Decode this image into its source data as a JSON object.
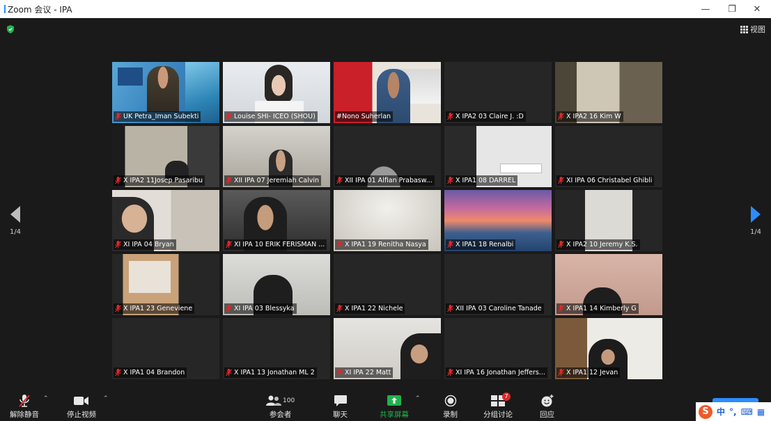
{
  "window": {
    "title": "Zoom 会议 - IPA"
  },
  "stage": {
    "view_label": "视图",
    "page_indicator_left": "1/4",
    "page_indicator_right": "1/4"
  },
  "participants": [
    {
      "name": "UK Petra_Iman Subekti",
      "muted": true,
      "active": false
    },
    {
      "name": "Louise SHI- ICEO (SHOU)",
      "muted": true,
      "active": false
    },
    {
      "name": "#Nono Suherlan",
      "muted": false,
      "active": true
    },
    {
      "name": "X IPA2 03 Claire J. :D",
      "muted": true,
      "active": false
    },
    {
      "name": "X IPA2 16 Kim W",
      "muted": true,
      "active": false
    },
    {
      "name": "X IPA2 11Josep Pasaribu",
      "muted": true,
      "active": false
    },
    {
      "name": "XII IPA 07 Jeremiah Calvin",
      "muted": true,
      "active": false
    },
    {
      "name": "XII IPA 01 Alfian Prabasw...",
      "muted": true,
      "active": false
    },
    {
      "name": "X IPA1 08 DARREL",
      "muted": true,
      "active": false
    },
    {
      "name": "XI IPA 06 Christabel Ghibli",
      "muted": true,
      "active": false
    },
    {
      "name": "XI IPA 04 Bryan",
      "muted": true,
      "active": false
    },
    {
      "name": "XI IPA 10 ERIK FERISMAN ...",
      "muted": true,
      "active": false
    },
    {
      "name": "X IPA1 19 Renitha Nasya",
      "muted": true,
      "active": false
    },
    {
      "name": "X IPA1 18 Renalbi",
      "muted": true,
      "active": false
    },
    {
      "name": "X IPA2 10 Jeremy K.S.",
      "muted": true,
      "active": false
    },
    {
      "name": "X IPA1 23 Geneviene",
      "muted": true,
      "active": false
    },
    {
      "name": "XI IPA 03 Blessyka",
      "muted": true,
      "active": false
    },
    {
      "name": "X IPA1 22 Nichele",
      "muted": true,
      "active": false
    },
    {
      "name": "XII IPA 03 Caroline Tanade",
      "muted": true,
      "active": false
    },
    {
      "name": "X IPA1 14 Kimberly G",
      "muted": true,
      "active": false
    },
    {
      "name": "X IPA1 04 Brandon",
      "muted": true,
      "active": false
    },
    {
      "name": "X IPA1 13 Jonathan ML 2",
      "muted": true,
      "active": false
    },
    {
      "name": "XI IPA 22 Matt",
      "muted": true,
      "active": false
    },
    {
      "name": "XI IPA 16 Jonathan Jeffers...",
      "muted": true,
      "active": false
    },
    {
      "name": "X IPA1 12 Jevan",
      "muted": true,
      "active": false
    }
  ],
  "toolbar": {
    "unmute": "解除静音",
    "stop_video": "停止视频",
    "participants": "参会者",
    "participants_count": "100",
    "chat": "聊天",
    "share_screen": "共享屏幕",
    "record": "录制",
    "breakout_rooms": "分组讨论",
    "breakout_badge": "7",
    "reactions": "回应"
  },
  "colors": {
    "active_speaker": "#c8e63c",
    "share_green": "#22b14c",
    "accent_blue": "#2d8cff",
    "mute_red": "#e02828"
  },
  "ime": {
    "logo": "S",
    "mode": "中"
  }
}
